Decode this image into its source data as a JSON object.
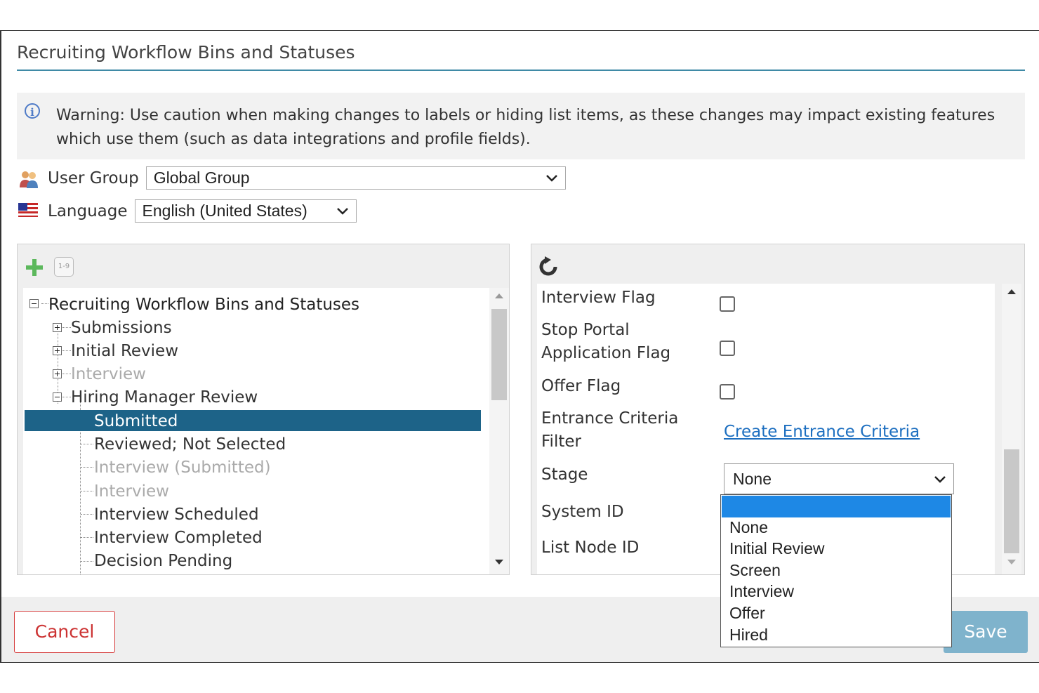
{
  "dialog": {
    "title": "Recruiting Workflow Bins and Statuses",
    "warning": "Warning: Use caution when making changes to labels or hiding list items, as these changes may impact existing features which use them (such as data integrations and profile fields)."
  },
  "filters": {
    "user_group_label": "User Group",
    "user_group_value": "Global Group",
    "language_label": "Language",
    "language_value": "English (United States)"
  },
  "tree": {
    "root": "Recruiting Workflow Bins and Statuses",
    "nodes": [
      "Submissions",
      "Initial Review",
      "Interview",
      "Hiring Manager Review"
    ],
    "children": [
      "Submitted",
      "Reviewed; Not Selected",
      "Interview (Submitted)",
      "Interview",
      "Interview Scheduled",
      "Interview Completed",
      "Decision Pending"
    ],
    "toolbar_icon_text": "1-9"
  },
  "properties": {
    "interview_flag": "Interview Flag",
    "stop_portal_line1": "Stop Portal",
    "stop_portal_line2": "Application Flag",
    "offer_flag": "Offer Flag",
    "entrance_line1": "Entrance Criteria",
    "entrance_line2": "Filter",
    "entrance_link": "Create Entrance Criteria",
    "stage_label": "Stage",
    "stage_value": "None",
    "system_id": "System ID",
    "list_node_id": "List Node ID"
  },
  "stage_options": [
    "",
    "None",
    "Initial Review",
    "Screen",
    "Interview",
    "Offer",
    "Hired"
  ],
  "footer": {
    "cancel": "Cancel",
    "save": "Save"
  },
  "colors": {
    "accent": "#1d6388",
    "link": "#1d6fc0",
    "cancel": "#d63c3c",
    "save": "#7fb3cc",
    "dropdown_highlight": "#1e88e5"
  }
}
